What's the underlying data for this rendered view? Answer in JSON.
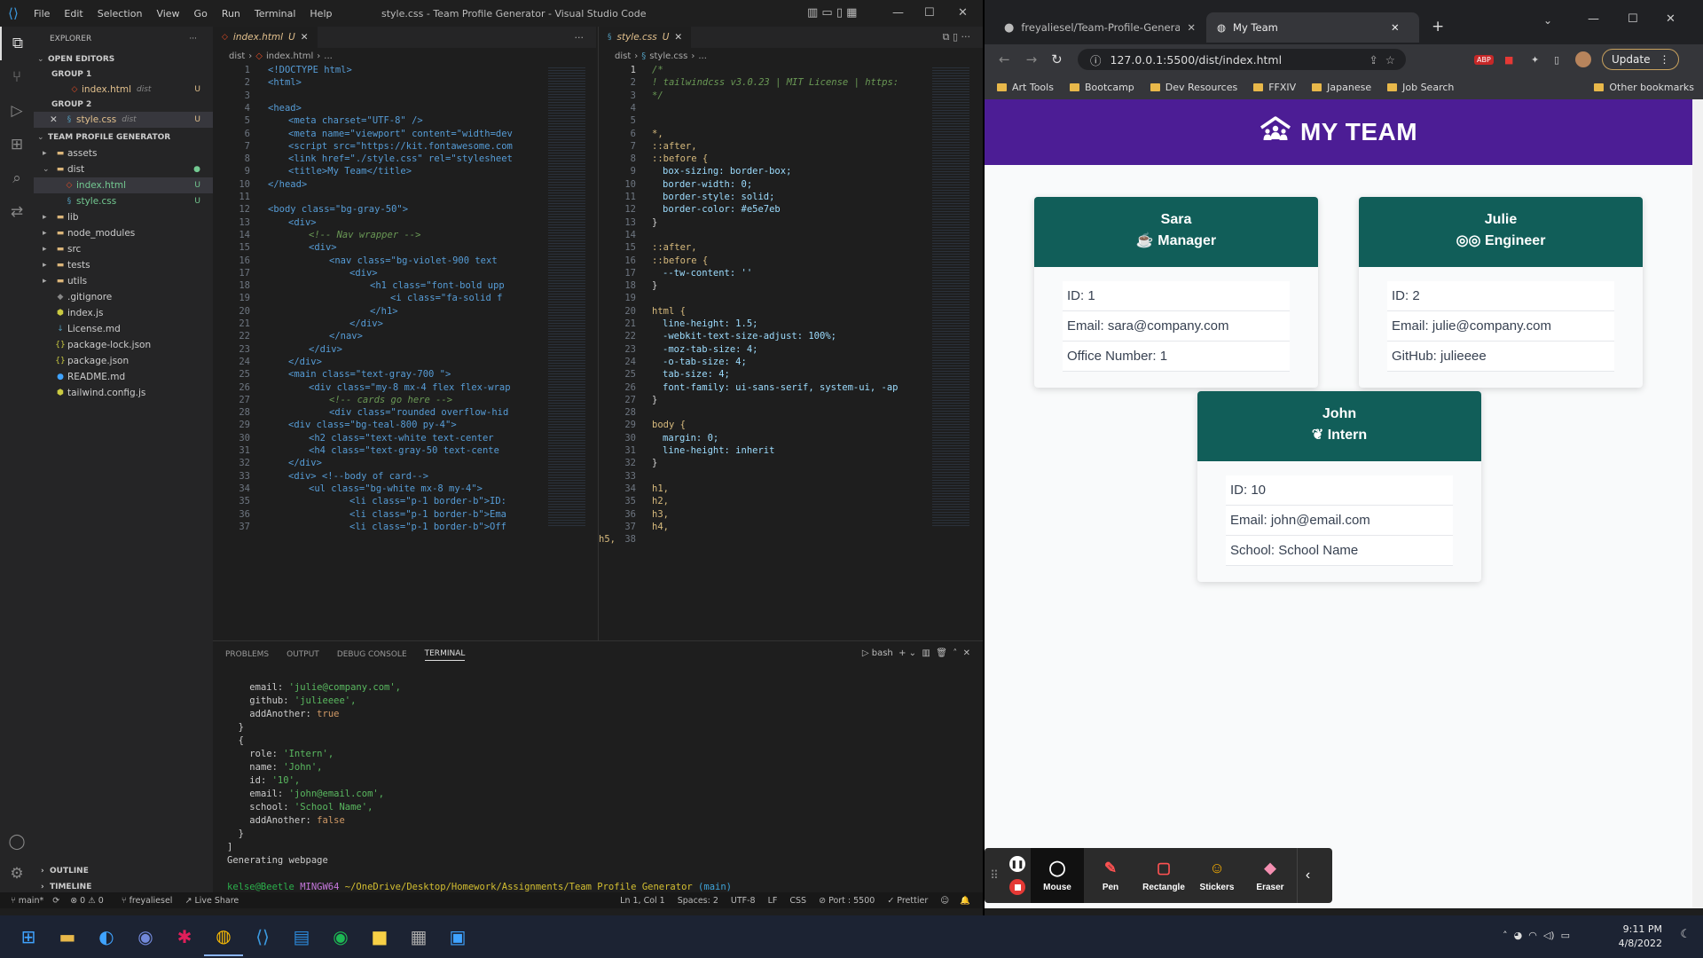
{
  "vscode": {
    "menu": [
      "File",
      "Edit",
      "Selection",
      "View",
      "Go",
      "Run",
      "Terminal",
      "Help"
    ],
    "window_title": "style.css - Team Profile Generator - Visual Studio Code",
    "explorer_header": "EXPLORER",
    "open_editors": "OPEN EDITORS",
    "group1": "GROUP 1",
    "group1_file": "index.html",
    "group1_hint": "dist",
    "group2": "GROUP 2",
    "group2_file": "style.css",
    "group2_hint": "dist",
    "badge_u": "U",
    "project": "TEAM PROFILE GENERATOR",
    "tree": [
      {
        "label": "assets",
        "kind": "folder"
      },
      {
        "label": "dist",
        "kind": "folder-open"
      },
      {
        "label": "index.html",
        "kind": "html",
        "badge": "U"
      },
      {
        "label": "style.css",
        "kind": "css",
        "badge": "U"
      },
      {
        "label": "lib",
        "kind": "folder"
      },
      {
        "label": "node_modules",
        "kind": "folder"
      },
      {
        "label": "src",
        "kind": "folder"
      },
      {
        "label": "tests",
        "kind": "folder"
      },
      {
        "label": "utils",
        "kind": "folder"
      },
      {
        "label": ".gitignore",
        "kind": "file"
      },
      {
        "label": "index.js",
        "kind": "js"
      },
      {
        "label": "License.md",
        "kind": "md"
      },
      {
        "label": "package-lock.json",
        "kind": "json"
      },
      {
        "label": "package.json",
        "kind": "json"
      },
      {
        "label": "README.md",
        "kind": "info"
      },
      {
        "label": "tailwind.config.js",
        "kind": "js"
      }
    ],
    "outline": "OUTLINE",
    "timeline": "TIMELINE",
    "tab_left": "index.html",
    "tab_left_mark": "U",
    "tab_right": "style.css",
    "tab_right_mark": "U",
    "crumb_left": [
      "dist",
      "index.html",
      "..."
    ],
    "crumb_right": [
      "dist",
      "style.css",
      "..."
    ],
    "html_lines": [
      "<!DOCTYPE html>",
      "<html>",
      "",
      "<head>",
      "<meta charset=\"UTF-8\" />",
      "<meta name=\"viewport\" content=\"width=dev",
      "<script src=\"https://kit.fontawesome.com",
      "<link href=\"./style.css\" rel=\"stylesheet",
      "<title>My Team</title>",
      "</head>",
      "",
      "<body class=\"bg-gray-50\">",
      "<div>",
      "<!-- Nav wrapper -->",
      "<div>",
      "<nav class=\"bg-violet-900 text",
      "<div>",
      "<h1 class=\"font-bold upp",
      "<i class=\"fa-solid f",
      "</h1>",
      "</div>",
      "</nav>",
      "</div>",
      "</div>",
      "<main class=\"text-gray-700 \">",
      "<div class=\"my-8 mx-4 flex flex-wrap",
      "<!-- cards go here -->",
      "<div class=\"rounded overflow-hid",
      "<div class=\"bg-teal-800 py-4\">",
      "<h2 class=\"text-white text-center",
      "<h4 class=\"text-gray-50 text-cente",
      "</div>",
      "<div> <!--body of card-->",
      "<ul class=\"bg-white mx-8 my-4\">",
      "<li class=\"p-1 border-b\">ID:",
      "<li class=\"p-1 border-b\">Ema",
      "<li class=\"p-1 border-b\">Off"
    ],
    "css_lines": [
      "/*",
      "! tailwindcss v3.0.23 | MIT License | https:",
      "*/",
      "",
      "",
      "*,",
      "::after,",
      "::before {",
      "box-sizing: border-box;",
      "border-width: 0;",
      "border-style: solid;",
      "border-color: #e5e7eb",
      "}",
      "",
      "::after,",
      "::before {",
      "--tw-content: ''",
      "}",
      "",
      "html {",
      "line-height: 1.5;",
      "-webkit-text-size-adjust: 100%;",
      "-moz-tab-size: 4;",
      "-o-tab-size: 4;",
      "tab-size: 4;",
      "font-family: ui-sans-serif, system-ui, -ap",
      "}",
      "",
      "body {",
      "margin: 0;",
      "line-height: inherit",
      "}",
      "",
      "h1,",
      "h2,",
      "h3,",
      "h4,",
      "h5,"
    ],
    "panel_tabs": [
      "PROBLEMS",
      "OUTPUT",
      "DEBUG CONSOLE",
      "TERMINAL"
    ],
    "shell": "bash",
    "terminal": {
      "email1": "'julie@company.com',",
      "github": "'julieeee',",
      "add1": "true",
      "role": "'Intern',",
      "name": "'John',",
      "id": "'10',",
      "email2": "'john@email.com',",
      "school": "'School Name',",
      "add2": "false",
      "generating": "Generating webpage",
      "prompt_user": "kelse@Beetle",
      "prompt_shell": "MINGW64",
      "prompt_path": "~/OneDrive/Desktop/Homework/Assignments/Team Profile Generator",
      "prompt_branch": "(main)",
      "dollar": "$"
    },
    "status": {
      "branch": "main*",
      "problems": "⊗ 0 ⚠ 0",
      "user": "freyaliesel",
      "liveshare": "Live Share",
      "cursor": "Ln 1, Col 1",
      "spaces": "Spaces: 2",
      "encoding": "UTF-8",
      "eol": "LF",
      "lang": "CSS",
      "port": "Port : 5500",
      "prettier": "Prettier"
    }
  },
  "chrome": {
    "tab1": "freyaliesel/Team-Profile-Generato",
    "tab2": "My Team",
    "url": "127.0.0.1:5500/dist/index.html",
    "update": "Update",
    "bookmarks": [
      "Art Tools",
      "Bootcamp",
      "Dev Resources",
      "FFXIV",
      "Japanese",
      "Job Search"
    ],
    "other_bookmarks": "Other bookmarks",
    "abp": "ABP"
  },
  "app": {
    "heading": "MY TEAM",
    "cards": [
      {
        "name": "Sara",
        "role": "Manager",
        "icon": "mug-icon",
        "items": [
          "ID: 1",
          "Email: sara@company.com",
          "Office Number: 1"
        ]
      },
      {
        "name": "Julie",
        "role": "Engineer",
        "icon": "glasses-icon",
        "items": [
          "ID: 2",
          "Email: julie@company.com",
          "GitHub: julieeee"
        ]
      },
      {
        "name": "John",
        "role": "Intern",
        "icon": "seedling-icon",
        "items": [
          "ID: 10",
          "Email: john@email.com",
          "School: School Name"
        ]
      }
    ]
  },
  "recorder": {
    "items": [
      "Mouse",
      "Pen",
      "Rectangle",
      "Stickers",
      "Eraser"
    ]
  },
  "taskbar": {
    "time": "9:11 PM",
    "date": "4/8/2022"
  },
  "colors": {
    "nav_bg": "#4c1d95",
    "card_head_bg": "#115e59",
    "editor_bg": "#1e1e1e"
  }
}
